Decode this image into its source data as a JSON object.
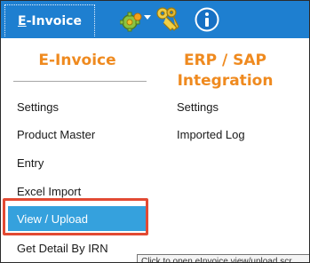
{
  "ribbon": {
    "tab": {
      "accel": "E",
      "rest": "-Invoice"
    },
    "icons": [
      "settings-gear-icon",
      "dropdown-arrow-icon",
      "keys-icon",
      "info-icon"
    ],
    "colors": {
      "ribbon_bg": "#1e7fd0",
      "heading": "#ef8a1f",
      "active_item": "#35a1dd",
      "highlight_border": "#e24a33"
    }
  },
  "columns": [
    {
      "heading": "E-Invoice",
      "items": [
        "Settings",
        "Product Master",
        "Entry",
        "Excel Import",
        "View / Upload",
        "Get Detail By IRN"
      ]
    },
    {
      "heading_line1": "ERP / SAP",
      "heading_line2": "Integration",
      "items": [
        "Settings",
        "Imported Log"
      ]
    }
  ],
  "active_item": "View / Upload",
  "tooltip": "Click to open eInvoice view/upload scr"
}
